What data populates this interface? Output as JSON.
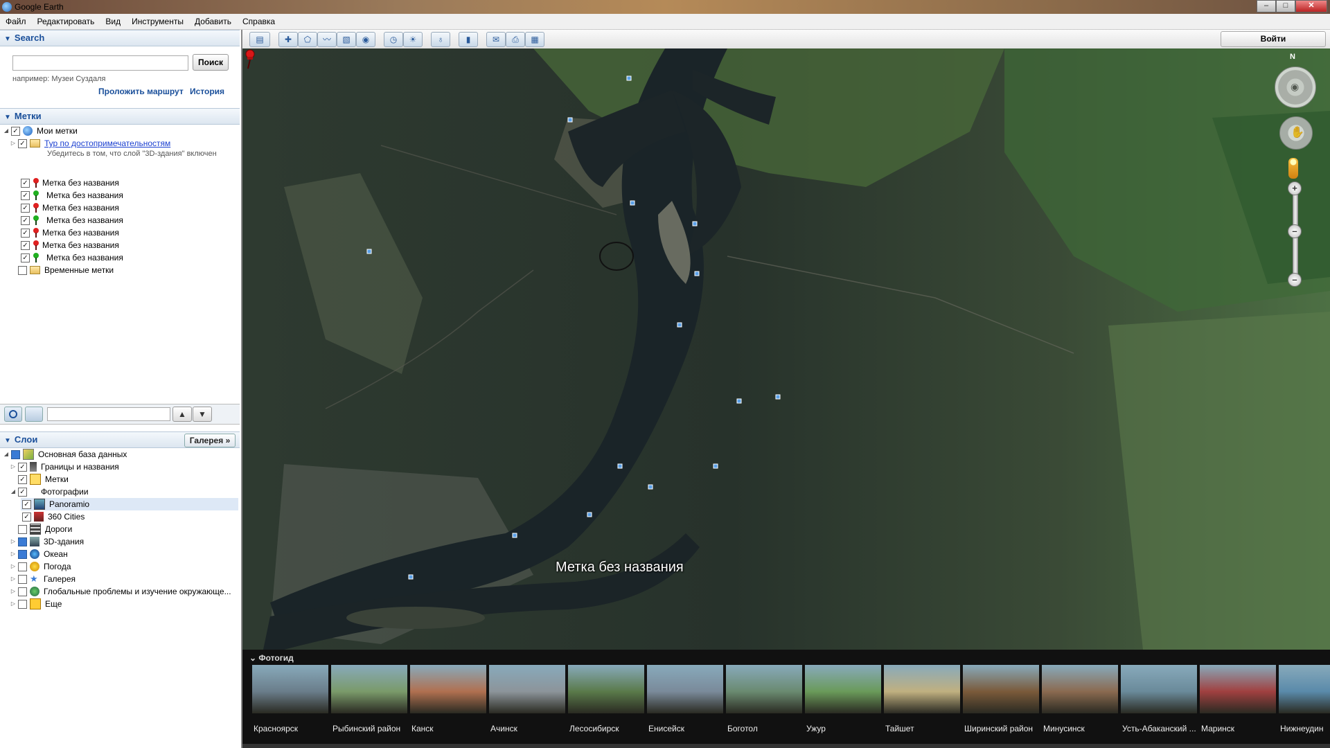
{
  "window": {
    "title": "Google Earth"
  },
  "menu": [
    "Файл",
    "Редактировать",
    "Вид",
    "Инструменты",
    "Добавить",
    "Справка"
  ],
  "search": {
    "header": "Search",
    "button_label": "Поиск",
    "example": "например: Музеи Суздаля",
    "route_link": "Проложить маршрут",
    "history_link": "История"
  },
  "places": {
    "header": "Метки",
    "root_label": "Мои метки",
    "tour_label": "Тур по достопримечательностям",
    "tour_hint": "Убедитесь в том, что слой \"3D-здания\" включен",
    "items": [
      {
        "label": "Метка без названия",
        "pin": "red"
      },
      {
        "label": "Метка без названия",
        "pin": "green"
      },
      {
        "label": "Метка без названия",
        "pin": "red"
      },
      {
        "label": "Метка без названия",
        "pin": "green"
      },
      {
        "label": "Метка без названия",
        "pin": "red"
      },
      {
        "label": "Метка без названия",
        "pin": "red"
      },
      {
        "label": "Метка без названия",
        "pin": "green"
      }
    ],
    "temp_label": "Временные метки"
  },
  "layers": {
    "header": "Слои",
    "gallery_button": "Галерея",
    "items": [
      "Основная база данных",
      "Границы и названия",
      "Метки",
      "Фотографии",
      "Panoramio",
      "360 Cities",
      "Дороги",
      "3D-здания",
      "Океан",
      "Погода",
      "Галерея",
      "Глобальные проблемы и изучение окружающе...",
      "Еще"
    ]
  },
  "toolbar": {
    "signin_label": "Войти"
  },
  "map": {
    "placemark_label": "Метка без названия",
    "compass_label": "N"
  },
  "photoguide": {
    "title": "Фотогид",
    "items": [
      {
        "caption": "Красноярск",
        "color": "#6a7d8a"
      },
      {
        "caption": "Рыбинский район",
        "color": "#7a9a6a"
      },
      {
        "caption": "Канск",
        "color": "#b07050"
      },
      {
        "caption": "Ачинск",
        "color": "#8c949a"
      },
      {
        "caption": "Лесосибирск",
        "color": "#5a7a4a"
      },
      {
        "caption": "Енисейск",
        "color": "#7a8a9a"
      },
      {
        "caption": "Боготол",
        "color": "#6a8a70"
      },
      {
        "caption": "Ужур",
        "color": "#6a9a5a"
      },
      {
        "caption": "Тайшет",
        "color": "#c0b080"
      },
      {
        "caption": "Ширинский район",
        "color": "#7a5a3a"
      },
      {
        "caption": "Минусинск",
        "color": "#8a6a50"
      },
      {
        "caption": "Усть-Абаканский ...",
        "color": "#6a8a9a"
      },
      {
        "caption": "Маринск",
        "color": "#a04040"
      },
      {
        "caption": "Нижнеудин",
        "color": "#5a8aaa"
      }
    ]
  }
}
